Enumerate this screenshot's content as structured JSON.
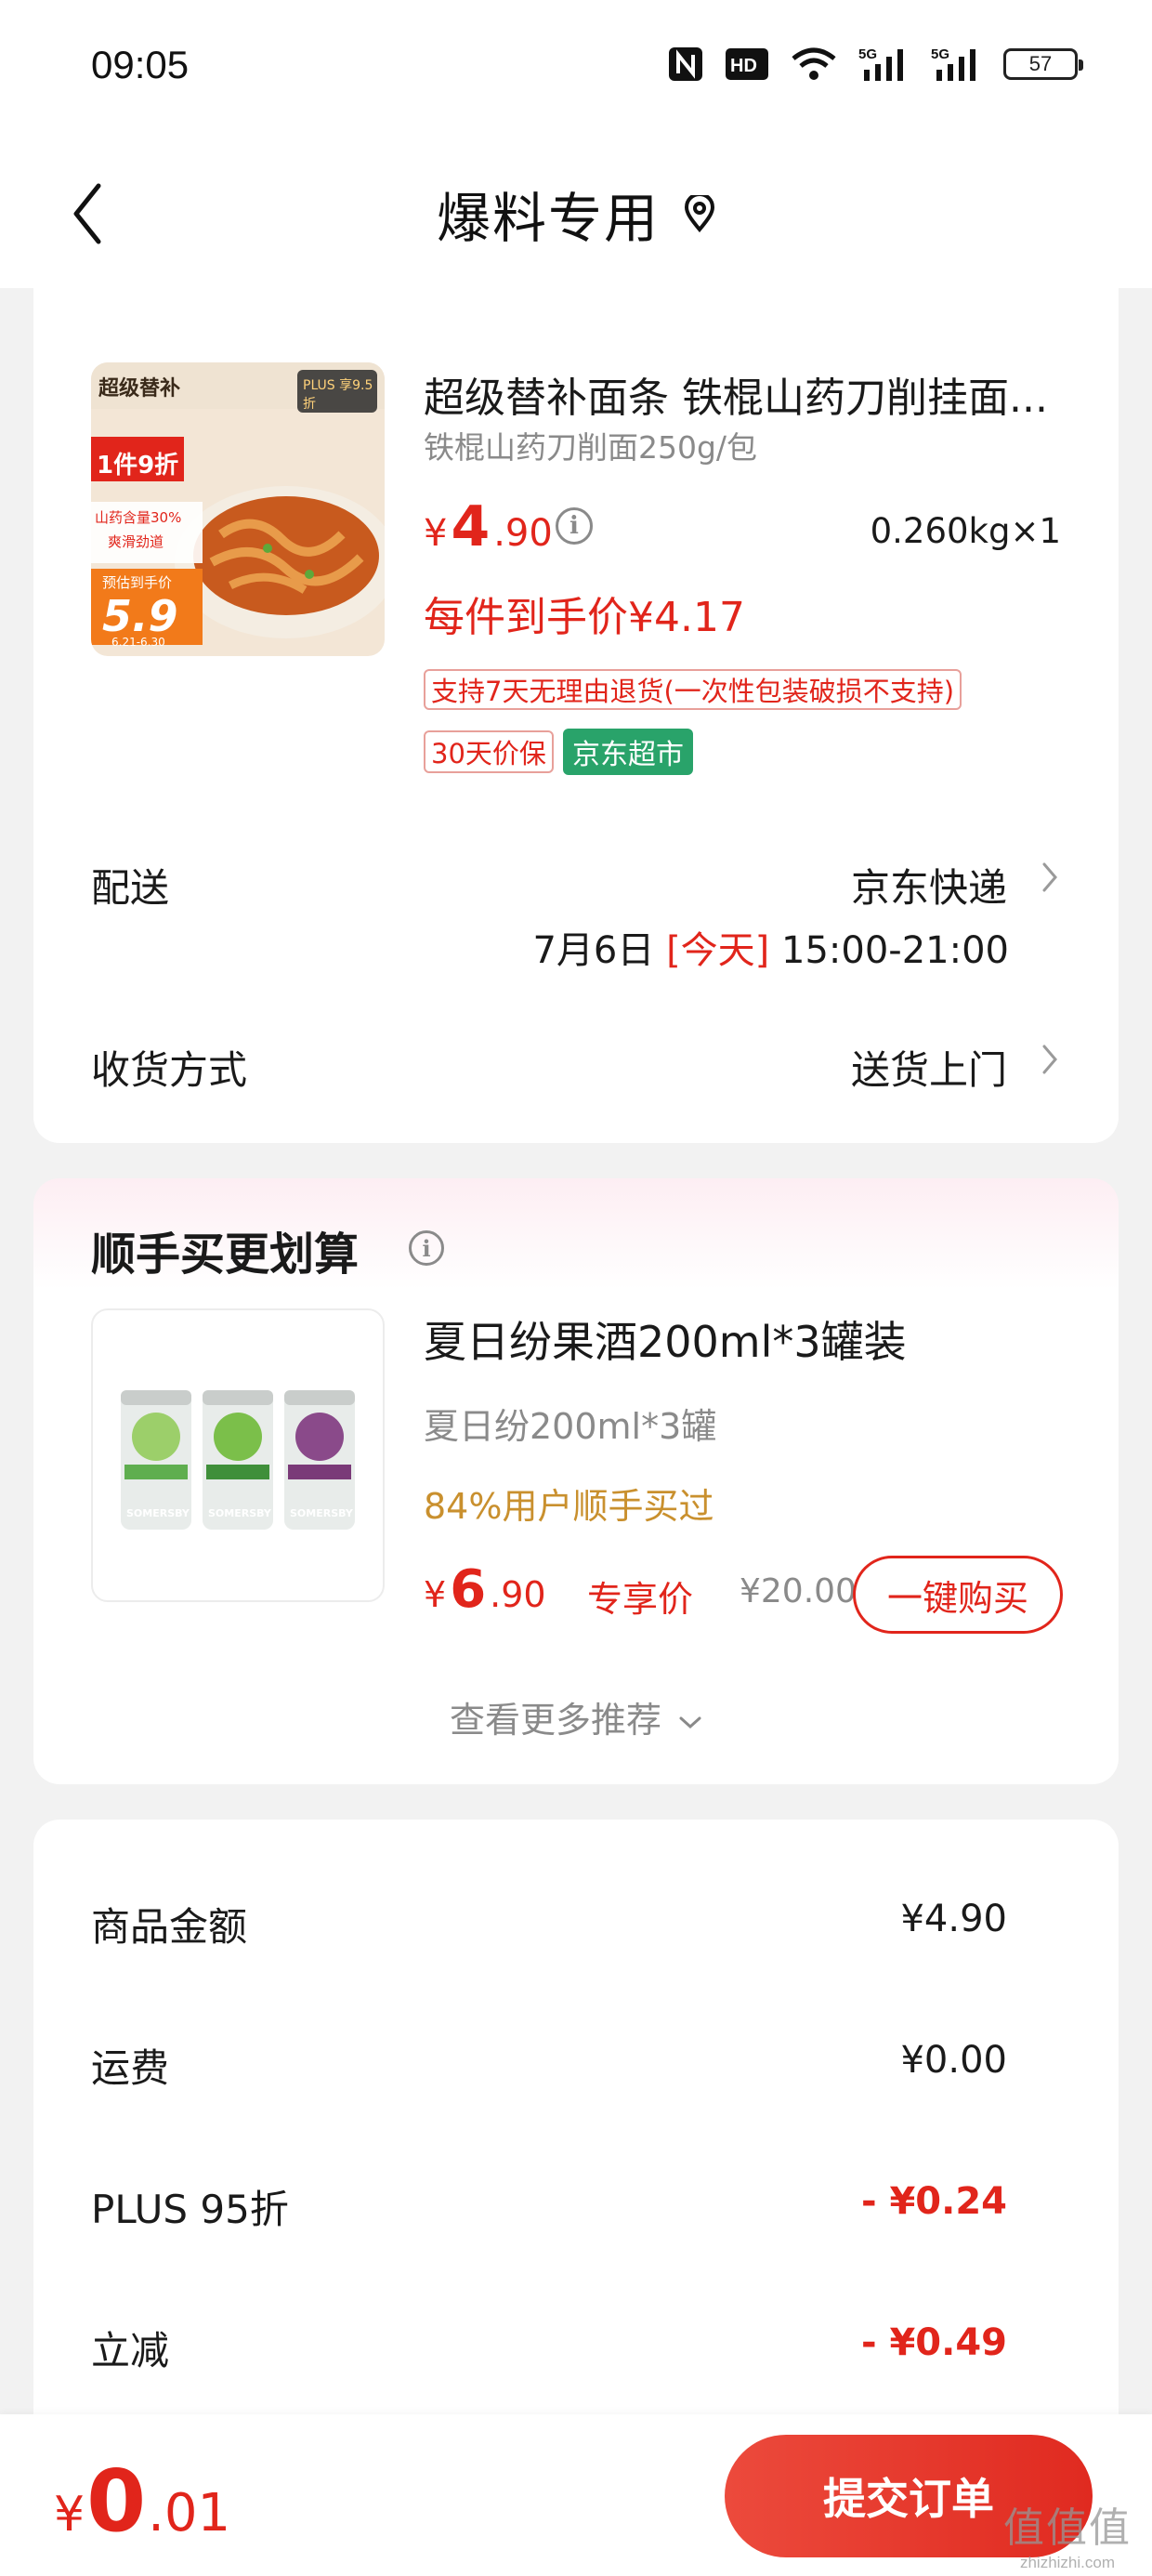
{
  "status_bar": {
    "time": "09:05",
    "battery": "57",
    "icons": [
      "nfc-icon",
      "hd-icon",
      "wifi-icon",
      "signal-5g-icon",
      "signal-5g-icon",
      "battery-icon"
    ]
  },
  "nav": {
    "title": "爆料专用",
    "icons": [
      "back-icon",
      "location-pin-icon"
    ]
  },
  "product": {
    "image_badges": {
      "brand": "超级替补",
      "discount": "1件9折",
      "feature_line1": "山药含量30%",
      "feature_line2": "爽滑劲道",
      "est_label": "预估到手价",
      "est_price": "5.9",
      "date_range": "6.21-6.30",
      "plus_tag": "PLUS 享9.5折"
    },
    "title": "超级替补面条 铁棍山药刀削挂面...",
    "spec": "铁棍山药刀削面250g/包",
    "price_currency": "¥",
    "price_int": "4",
    "price_dec": ".90",
    "weight": "0.260kg×1",
    "final_price": "每件到手价¥4.17",
    "return_tag": "支持7天无理由退货(一次性包装破损不支持)",
    "price_protect_tag": "30天价保",
    "market_tag": "京东超市"
  },
  "delivery": {
    "label": "配送",
    "value": "京东快递",
    "date": "7月6日",
    "today": "[今天]",
    "time_range": "15:00-21:00"
  },
  "receive": {
    "label": "收货方式",
    "value": "送货上门"
  },
  "recommend": {
    "title": "顺手买更划算",
    "item_name": "夏日纷果酒200ml*3罐装",
    "item_spec": "夏日纷200ml*3罐",
    "bought_text": "84%用户顺手买过",
    "price_currency": "¥",
    "price_int": "6",
    "price_dec": ".90",
    "exclusive_label": "专享价",
    "original_price": "¥20.00",
    "buy_button": "一键购买",
    "more": "查看更多推荐",
    "can_brand": "SOMERSBY",
    "colors": {
      "can_green": "#5fae4f",
      "can_purple": "#7a3a78"
    }
  },
  "costs": [
    {
      "label": "商品金额",
      "value": "¥4.90",
      "red": false
    },
    {
      "label": "运费",
      "value": "¥0.00",
      "red": false
    },
    {
      "label": "PLUS 95折",
      "value": "- ¥0.24",
      "red": true
    },
    {
      "label": "立减",
      "value": "- ¥0.49",
      "red": true
    }
  ],
  "bottom": {
    "total_currency": "¥",
    "total_int": "0",
    "total_dec": ".01",
    "submit": "提交订单"
  },
  "watermark": {
    "main": "值值值",
    "sub": "zhizhizhi.com"
  },
  "colors": {
    "accent": "#e1251b",
    "market_green": "#29a36a",
    "bought_gold": "#c9902e"
  }
}
